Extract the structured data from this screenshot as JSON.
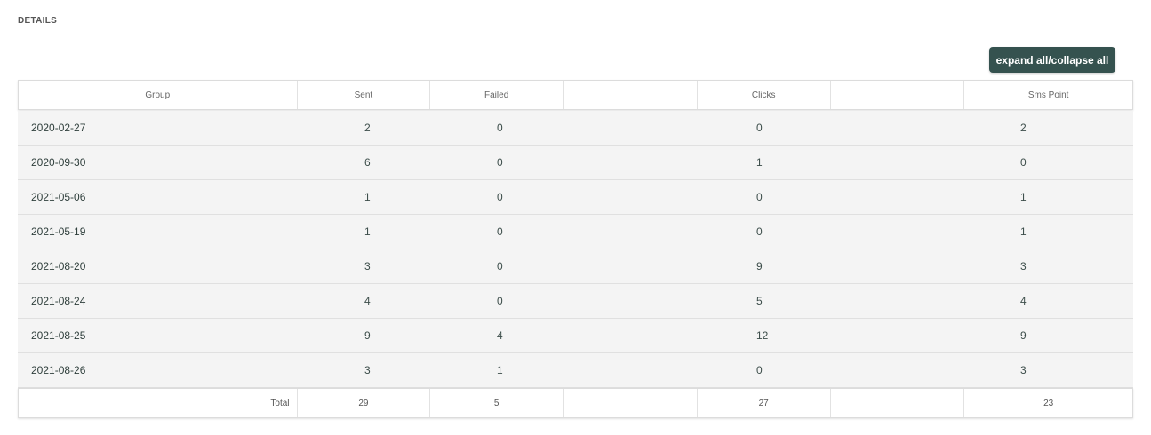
{
  "section": {
    "title": "DETAILS"
  },
  "toolbar": {
    "expand_label": "expand all/collapse all"
  },
  "table": {
    "columns": [
      "Group",
      "Sent",
      "Failed",
      "",
      "Clicks",
      "",
      "Sms Point"
    ],
    "rows": [
      {
        "group": "2020-02-27",
        "sent": "2",
        "failed": "0",
        "clicks": "0",
        "sms_point": "2"
      },
      {
        "group": "2020-09-30",
        "sent": "6",
        "failed": "0",
        "clicks": "1",
        "sms_point": "0"
      },
      {
        "group": "2021-05-06",
        "sent": "1",
        "failed": "0",
        "clicks": "0",
        "sms_point": "1"
      },
      {
        "group": "2021-05-19",
        "sent": "1",
        "failed": "0",
        "clicks": "0",
        "sms_point": "1"
      },
      {
        "group": "2021-08-20",
        "sent": "3",
        "failed": "0",
        "clicks": "9",
        "sms_point": "3"
      },
      {
        "group": "2021-08-24",
        "sent": "4",
        "failed": "0",
        "clicks": "5",
        "sms_point": "4"
      },
      {
        "group": "2021-08-25",
        "sent": "9",
        "failed": "4",
        "clicks": "12",
        "sms_point": "9"
      },
      {
        "group": "2021-08-26",
        "sent": "3",
        "failed": "1",
        "clicks": "0",
        "sms_point": "3"
      }
    ],
    "totals": {
      "label": "Total",
      "sent": "29",
      "failed": "5",
      "clicks": "27",
      "sms_point": "23"
    }
  },
  "colors": {
    "button_bg": "#35524f",
    "row_bg": "#f4f4f4",
    "text": "#3c4d4a"
  }
}
